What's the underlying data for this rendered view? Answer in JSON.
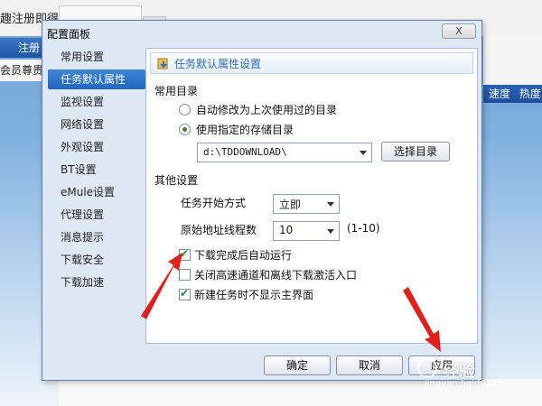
{
  "background_app": {
    "title": "趣注册即得",
    "login_label": "注册",
    "vip_text": "会员尊贵特权",
    "columns": [
      "速度",
      "热度"
    ]
  },
  "dialog": {
    "title": "配置面板",
    "close_label": "X"
  },
  "nav": {
    "items": [
      {
        "label": "常用设置"
      },
      {
        "label": "任务默认属性"
      },
      {
        "label": "监视设置"
      },
      {
        "label": "网络设置"
      },
      {
        "label": "外观设置"
      },
      {
        "label": "BT设置"
      },
      {
        "label": "eMule设置"
      },
      {
        "label": "代理设置"
      },
      {
        "label": "消息提示"
      },
      {
        "label": "下载安全"
      },
      {
        "label": "下载加速"
      }
    ],
    "selected_index": 1
  },
  "panel": {
    "header": "任务默认属性设置",
    "common_dir": {
      "title": "常用目录",
      "option_auto": "自动修改为上次使用过的目录",
      "option_specified": "使用指定的存储目录",
      "selected": "specified",
      "path_value": "d:\\TDDOWNLOAD\\",
      "choose_dir_label": "选择目录"
    },
    "other": {
      "title": "其他设置",
      "start_mode_label": "任务开始方式",
      "start_mode_value": "立即",
      "threads_label": "原始地址线程数",
      "threads_value": "10",
      "threads_range": "(1-10)",
      "checkboxes": [
        {
          "label": "下载完成后自动运行",
          "checked": true
        },
        {
          "label": "关闭高速通道和离线下载激活入口",
          "checked": false
        },
        {
          "label": "新建任务时不显示主界面",
          "checked": true
        }
      ]
    }
  },
  "buttons": {
    "ok": "确定",
    "cancel": "取消",
    "apply": "应用"
  },
  "watermark": {
    "text": "经验",
    "sub": "jingyan.baidu.com"
  },
  "colors": {
    "accent": "#2266c0",
    "arrow": "#e0201b",
    "check": "#1f8f2a"
  }
}
